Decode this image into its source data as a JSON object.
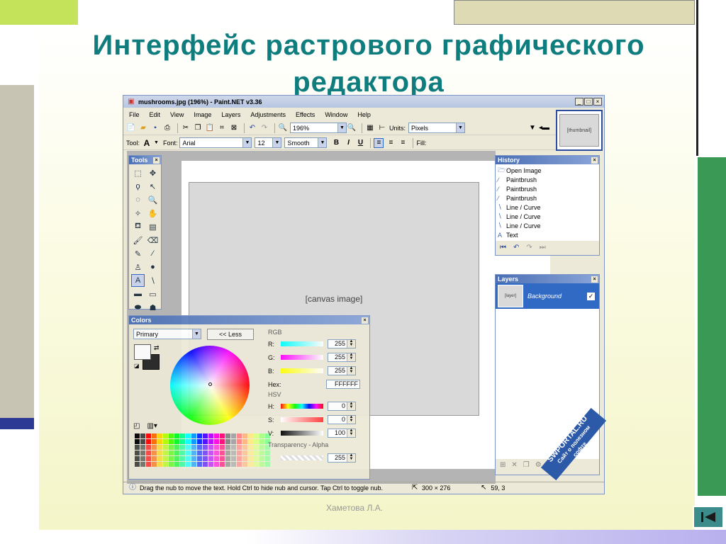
{
  "slide": {
    "title_line1": "Интерфейс растрового графического",
    "title_line2": "редактора",
    "author": "Хаметова Л.А.",
    "nav_icon": "first-slide-icon"
  },
  "window": {
    "title": "mushrooms.jpg (196%) - Paint.NET v3.36",
    "menu": [
      "File",
      "Edit",
      "View",
      "Image",
      "Layers",
      "Adjustments",
      "Effects",
      "Window",
      "Help"
    ],
    "zoom": "196%",
    "units_label": "Units:",
    "units_value": "Pixels",
    "tool_label": "Tool:",
    "font_label": "Font:",
    "font_value": "Arial",
    "font_size": "12",
    "smoothing": "Smooth",
    "bold": "B",
    "italic": "I",
    "underline": "U",
    "fill_label": "Fill:"
  },
  "tools_panel": {
    "title": "Tools",
    "tools": [
      "rectangle-select-icon",
      "move-selection-icon",
      "lasso-select-icon",
      "move-selected-icon",
      "ellipse-select-icon",
      "zoom-icon",
      "magic-wand-icon",
      "pan-icon",
      "paint-bucket-icon",
      "gradient-icon",
      "paintbrush-icon",
      "eraser-icon",
      "pencil-icon",
      "color-picker-icon",
      "clone-stamp-icon",
      "recolor-icon",
      "text-icon",
      "line-curve-icon",
      "rectangle-icon",
      "rounded-rectangle-icon",
      "ellipse-icon",
      "freeform-shape-icon"
    ]
  },
  "history_panel": {
    "title": "History",
    "items": [
      {
        "label": "Open Image",
        "icon": "folder-icon"
      },
      {
        "label": "Paintbrush",
        "icon": "paintbrush-icon"
      },
      {
        "label": "Paintbrush",
        "icon": "paintbrush-icon"
      },
      {
        "label": "Paintbrush",
        "icon": "paintbrush-icon"
      },
      {
        "label": "Line / Curve",
        "icon": "line-curve-icon"
      },
      {
        "label": "Line / Curve",
        "icon": "line-curve-icon"
      },
      {
        "label": "Line / Curve",
        "icon": "line-curve-icon"
      },
      {
        "label": "Text",
        "icon": "text-icon"
      }
    ]
  },
  "layers_panel": {
    "title": "Layers",
    "layer_name": "Background",
    "layer_visible": true
  },
  "colors_panel": {
    "title": "Colors",
    "mode": "Primary",
    "less_button": "<< Less",
    "rgb_label": "RGB",
    "r_label": "R:",
    "r_value": "255",
    "g_label": "G:",
    "g_value": "255",
    "b_label": "B:",
    "b_value": "255",
    "hex_label": "Hex:",
    "hex_value": "FFFFFF",
    "hsv_label": "HSV",
    "h_label": "H:",
    "h_value": "0",
    "s_label": "S:",
    "s_value": "0",
    "v_label": "V:",
    "v_value": "100",
    "alpha_label": "Transparency - Alpha",
    "alpha_value": "255"
  },
  "status": {
    "hint": "Drag the nub to move the text. Hold Ctrl to hide nub and cursor. Tap Ctrl to toggle nub.",
    "size": "300 × 276",
    "cursor": "59, 3"
  },
  "watermark": {
    "line1": "SWPORTAL.RU",
    "line2": "Сайт о полезном",
    "line3": "софте"
  }
}
